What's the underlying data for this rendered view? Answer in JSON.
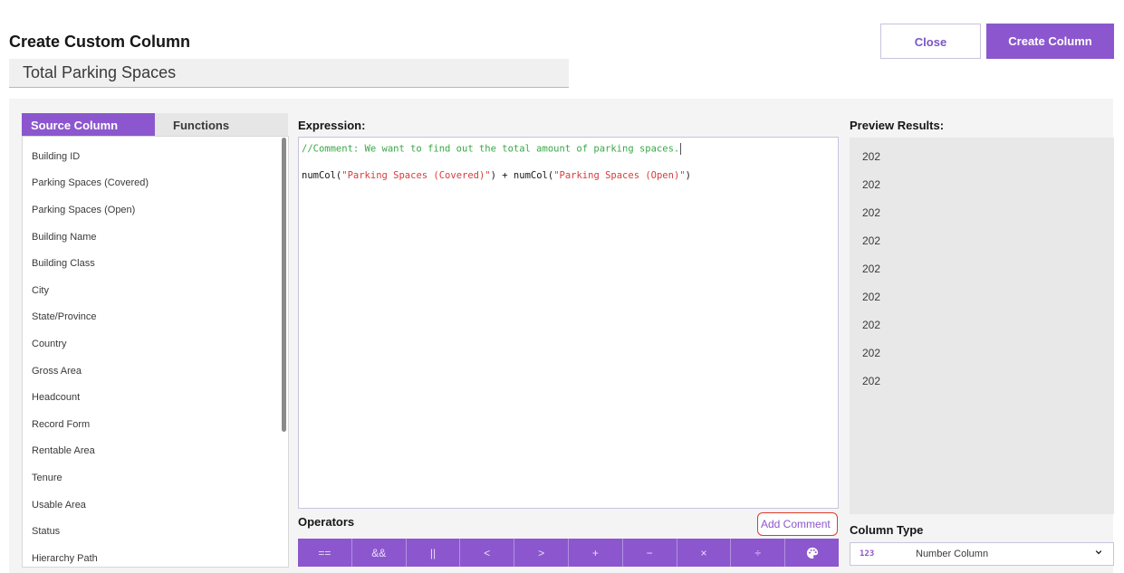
{
  "header": {
    "title": "Create Custom Column",
    "column_name": "Total Parking Spaces",
    "close_label": "Close",
    "create_label": "Create Column"
  },
  "left_panel": {
    "tabs": [
      "Source Column",
      "Functions"
    ],
    "columns": [
      "Building ID",
      "Parking Spaces (Covered)",
      "Parking Spaces (Open)",
      "Building Name",
      "Building Class",
      "City",
      "State/Province",
      "Country",
      "Gross Area",
      "Headcount",
      "Record Form",
      "Rentable Area",
      "Tenure",
      "Usable Area",
      "Status",
      "Hierarchy Path"
    ]
  },
  "expression": {
    "label": "Expression:",
    "comment_line": "//Comment: We want to find out the total amount of parking spaces.",
    "code": {
      "fn1": "numCol(",
      "arg1": "\"Parking Spaces (Covered)\"",
      "mid": ") + numCol(",
      "arg2": "\"Parking Spaces (Open)\"",
      "end": ")"
    }
  },
  "operators": {
    "label": "Operators",
    "add_comment_label": "Add Comment",
    "buttons": [
      "==",
      "&&",
      "||",
      "<",
      ">",
      "+",
      "−",
      "×",
      "÷"
    ],
    "last_icon": "palette-icon"
  },
  "preview": {
    "label": "Preview Results:",
    "values": [
      "202",
      "202",
      "202",
      "202",
      "202",
      "202",
      "202",
      "202",
      "202"
    ]
  },
  "column_type": {
    "label": "Column Type",
    "icon_text": "123",
    "value": "Number Column"
  },
  "colors": {
    "accent": "#8c57ce",
    "comment": "#3aa847",
    "string": "#d93b3b",
    "highlight_border": "#e03b24"
  }
}
